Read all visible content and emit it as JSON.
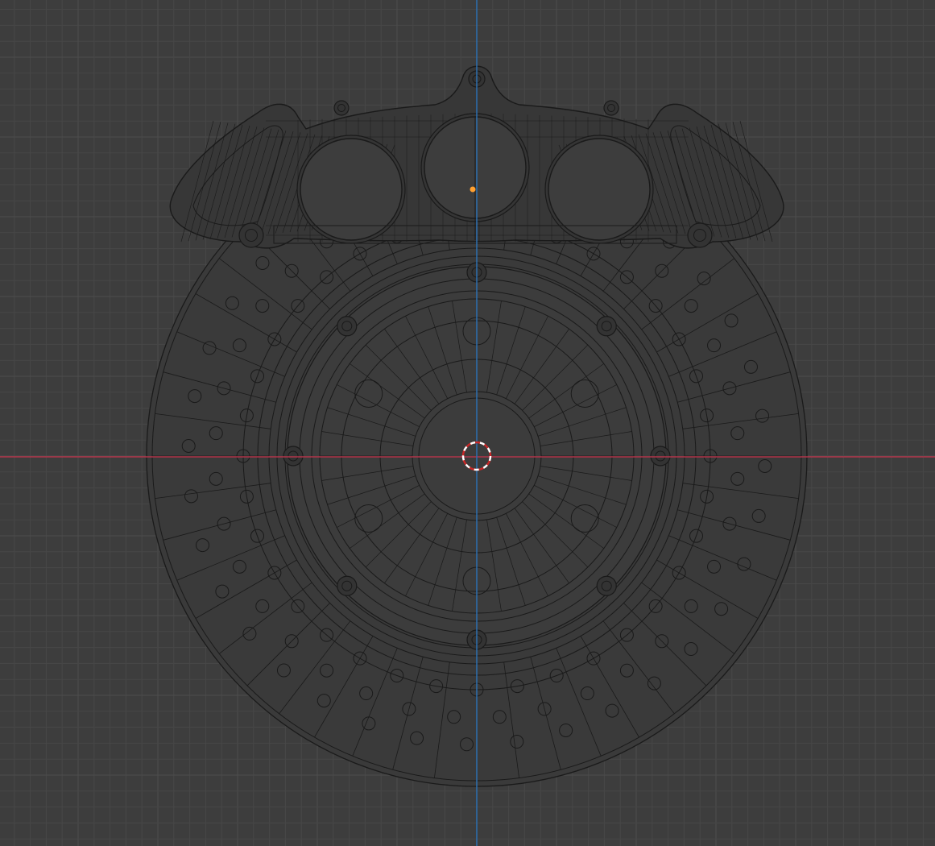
{
  "viewport": {
    "colors": {
      "background": "#3d3d3d",
      "grid_minor": "#474747",
      "grid_major": "#4d4d4d",
      "x_axis": "#b1344a",
      "z_axis": "#2c6fb0",
      "wire": "#1a1a1a",
      "origin_dot": "#ffa030",
      "cursor_red": "#c82828",
      "cursor_white": "#ffffff"
    },
    "view": "front-orthographic"
  },
  "scene_objects": {
    "rotor": {
      "name": "brake-disc-rotor",
      "drill_holes_per_ring": 36,
      "spokes": 48
    },
    "hub": {
      "name": "hub",
      "bolt_count": 8,
      "vent_hole_count": 6
    },
    "caliper": {
      "name": "brake-caliper",
      "piston_count": 3
    }
  },
  "icons": {
    "cursor": "3d-cursor-icon",
    "origin": "object-origin-icon"
  }
}
